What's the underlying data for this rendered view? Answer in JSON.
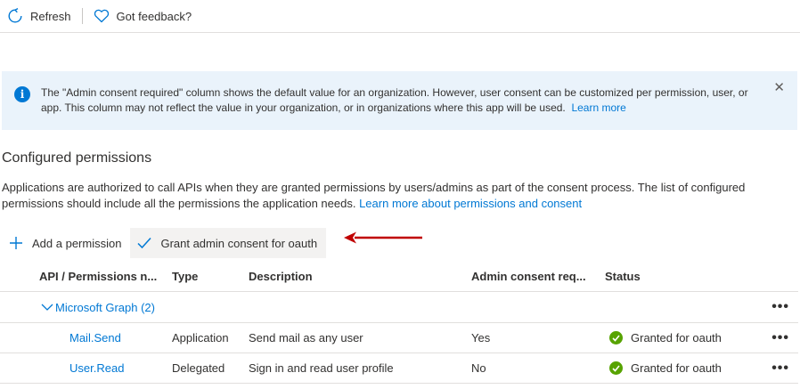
{
  "toolbar": {
    "refresh_label": "Refresh",
    "feedback_label": "Got feedback?"
  },
  "banner": {
    "text": "The \"Admin consent required\" column shows the default value for an organization. However, user consent can be customized per permission, user, or app. This column may not reflect the value in your organization, or in organizations where this app will be used.",
    "link": "Learn more",
    "close": "✕",
    "info_icon": "i"
  },
  "section": {
    "title": "Configured permissions",
    "description": "Applications are authorized to call APIs when they are granted permissions by users/admins as part of the consent process. The list of configured permissions should include all the permissions the application needs.",
    "description_link": "Learn more about permissions and consent"
  },
  "actions": {
    "add_label": "Add a permission",
    "grant_label": "Grant admin consent for oauth"
  },
  "table": {
    "headers": [
      "API / Permissions n...",
      "Type",
      "Description",
      "Admin consent req...",
      "Status"
    ],
    "group": {
      "label": "Microsoft Graph (2)",
      "more": "•••"
    },
    "rows": [
      {
        "name": "Mail.Send",
        "type": "Application",
        "description": "Send mail as any user",
        "admin": "Yes",
        "status": "Granted for oauth",
        "more": "•••"
      },
      {
        "name": "User.Read",
        "type": "Delegated",
        "description": "Sign in and read user profile",
        "admin": "No",
        "status": "Granted for oauth",
        "more": "•••"
      }
    ]
  },
  "colors": {
    "accent": "#0078d4",
    "banner_bg": "#eaf3fb",
    "success": "#57a300",
    "annotation_arrow": "#c00000"
  }
}
